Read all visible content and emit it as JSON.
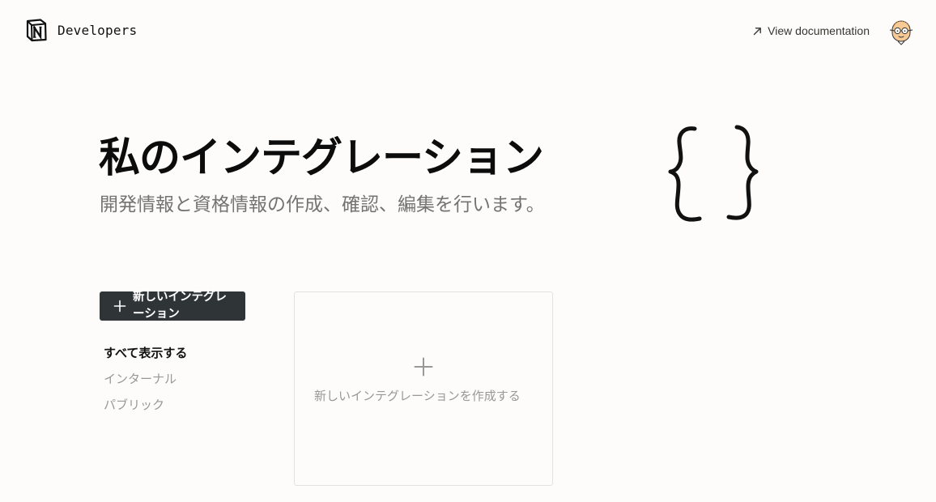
{
  "header": {
    "brand_name": "Developers",
    "docs_link_label": "View documentation",
    "logo_icon": "notion-logo-icon",
    "docs_icon": "arrow-up-right-icon",
    "avatar_icon": "user-avatar-illustration"
  },
  "hero": {
    "title": "私のインテグレーション",
    "subtitle": "開発情報と資格情報の作成、確認、編集を行います。",
    "illustration": "curly-braces-icon"
  },
  "sidebar": {
    "new_integration_label": "新しいインテグレーション",
    "new_integration_icon": "plus-icon",
    "filters": [
      {
        "label": "すべて表示する",
        "active": true
      },
      {
        "label": "インターナル",
        "active": false
      },
      {
        "label": "パブリック",
        "active": false
      }
    ]
  },
  "main": {
    "create_card": {
      "label": "新しいインテグレーションを作成する",
      "icon": "plus-icon"
    }
  },
  "colors": {
    "background": "#fdfcfb",
    "button_bg": "#2f3437",
    "muted_text": "#9a9893",
    "subtitle_text": "#75736f",
    "card_border": "#e4e2dd"
  }
}
